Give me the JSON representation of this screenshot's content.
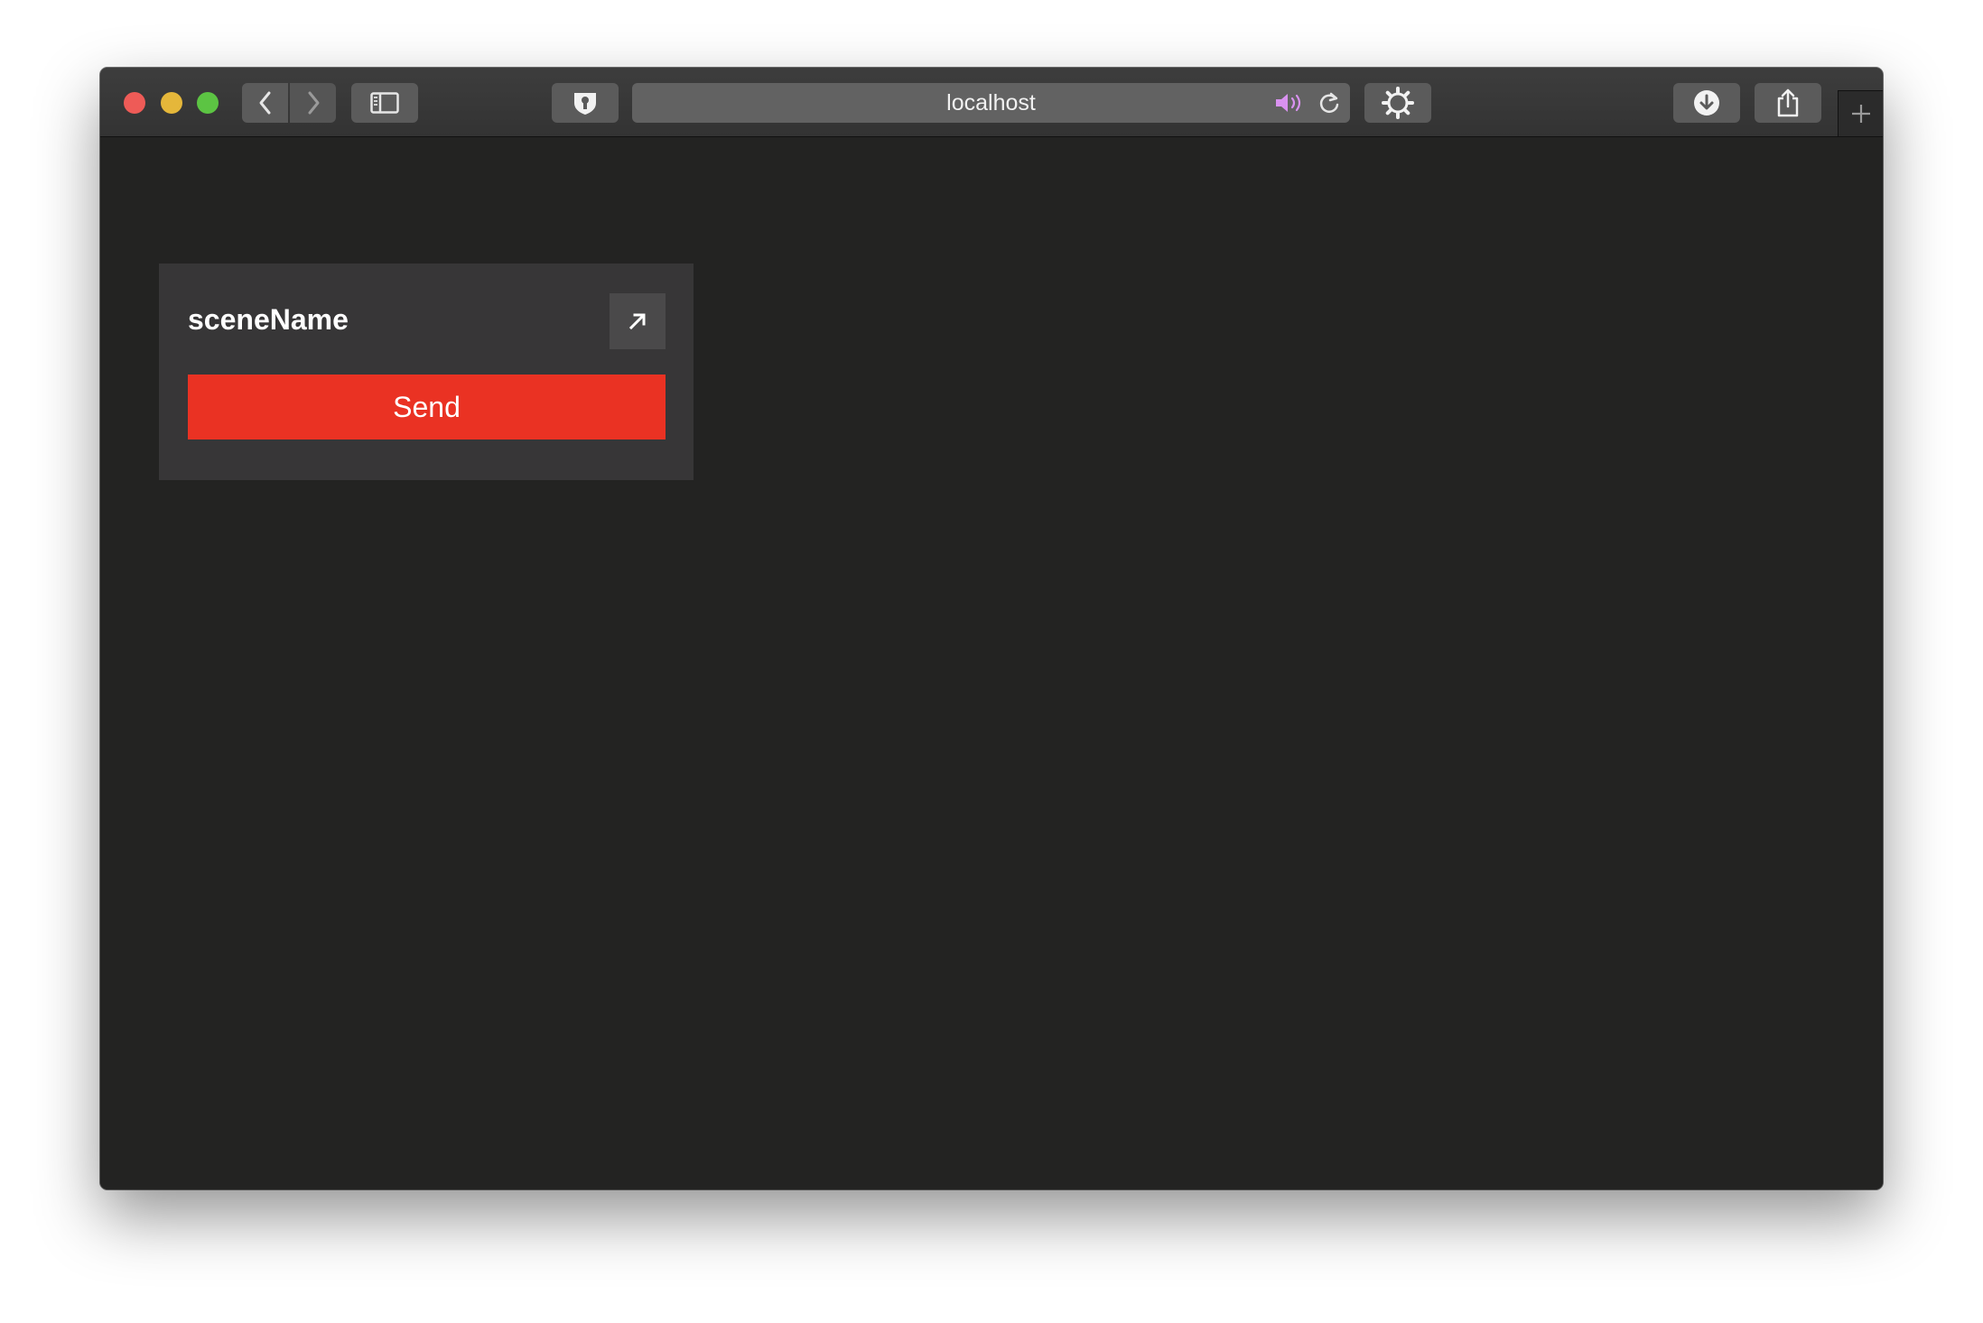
{
  "browser": {
    "url": "localhost",
    "icons": {
      "close": "close-window-icon",
      "minimize": "minimize-window-icon",
      "zoom": "zoom-window-icon",
      "back": "chevron-left-icon",
      "forward": "chevron-right-icon",
      "sidebar": "sidebar-icon",
      "extension": "shield-extension-icon",
      "audio": "speaker-icon",
      "reload": "reload-icon",
      "settings": "gear-icon",
      "downloads": "download-icon",
      "share": "share-icon",
      "new_tab": "plus-icon"
    },
    "colors": {
      "close": "#ee5b57",
      "minimize": "#e5b73a",
      "zoom": "#5cc443",
      "audio": "#d992f0"
    }
  },
  "panel": {
    "title": "sceneName",
    "expand_icon": "arrow-up-right-icon",
    "send_label": "Send",
    "colors": {
      "background": "#232322",
      "card": "#373637",
      "send_button": "#ea3223"
    }
  }
}
